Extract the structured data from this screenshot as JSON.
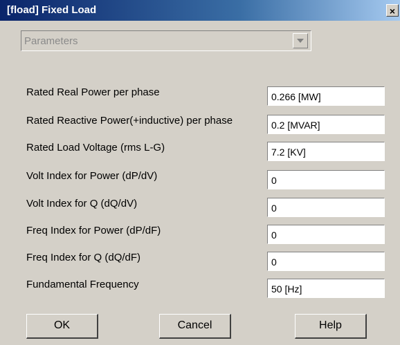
{
  "window": {
    "title": "[fload] Fixed Load",
    "close_glyph": "×"
  },
  "dropdown": {
    "label": "Parameters"
  },
  "params": [
    {
      "label": "Rated Real Power per phase",
      "value": "0.266 [MW]"
    },
    {
      "label": "Rated Reactive Power(+inductive) per phase",
      "value": "0.2 [MVAR]"
    },
    {
      "label": "Rated Load Voltage (rms L-G)",
      "value": "7.2 [KV]"
    },
    {
      "label": "Volt Index for Power (dP/dV)",
      "value": "0"
    },
    {
      "label": "Volt Index for Q (dQ/dV)",
      "value": "0"
    },
    {
      "label": "Freq Index for Power (dP/dF)",
      "value": "0"
    },
    {
      "label": "Freq Index for Q (dQ/dF)",
      "value": "0"
    },
    {
      "label": "Fundamental Frequency",
      "value": "50 [Hz]"
    }
  ],
  "buttons": {
    "ok": "OK",
    "cancel": "Cancel",
    "help": "Help"
  }
}
